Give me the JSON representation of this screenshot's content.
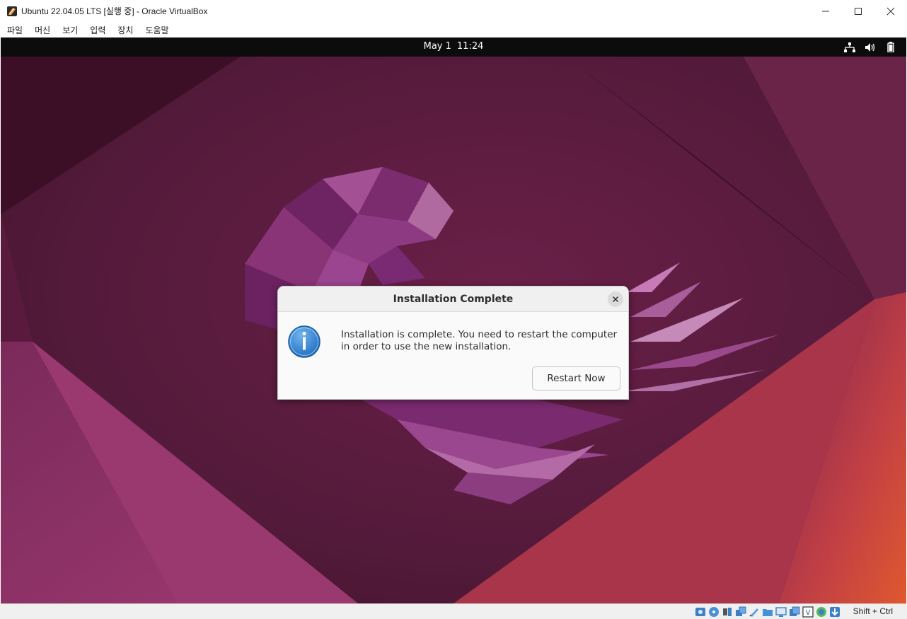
{
  "host_window": {
    "title": "Ubuntu 22.04.05 LTS [실행 중] - Oracle VirtualBox",
    "menu": [
      "파일",
      "머신",
      "보기",
      "입력",
      "장치",
      "도움말"
    ]
  },
  "topbar": {
    "date": "May 1",
    "time": "11:24",
    "tray_icons": [
      "network-icon",
      "volume-icon",
      "battery-icon"
    ]
  },
  "dialog": {
    "title": "Installation Complete",
    "message_line1": "Installation is complete. You need to restart the computer",
    "message_line2": "in order to use the new installation.",
    "button_label": "Restart Now",
    "icon": "info-icon"
  },
  "statusbar": {
    "host_key": "Shift + Ctrl",
    "icons": [
      "hard-disk-icon",
      "optical-drive-icon",
      "audio-icon",
      "network-adapter-icon",
      "usb-icon",
      "shared-folders-icon",
      "display-icon",
      "recording-icon",
      "cpu-icon",
      "guest-additions-icon",
      "mouse-integration-icon"
    ]
  },
  "colors": {
    "wallpaper_dark": "#3e1029",
    "wallpaper_mid": "#7a2855",
    "wallpaper_orange": "#d4483a",
    "info_blue": "#3d8fd9"
  }
}
